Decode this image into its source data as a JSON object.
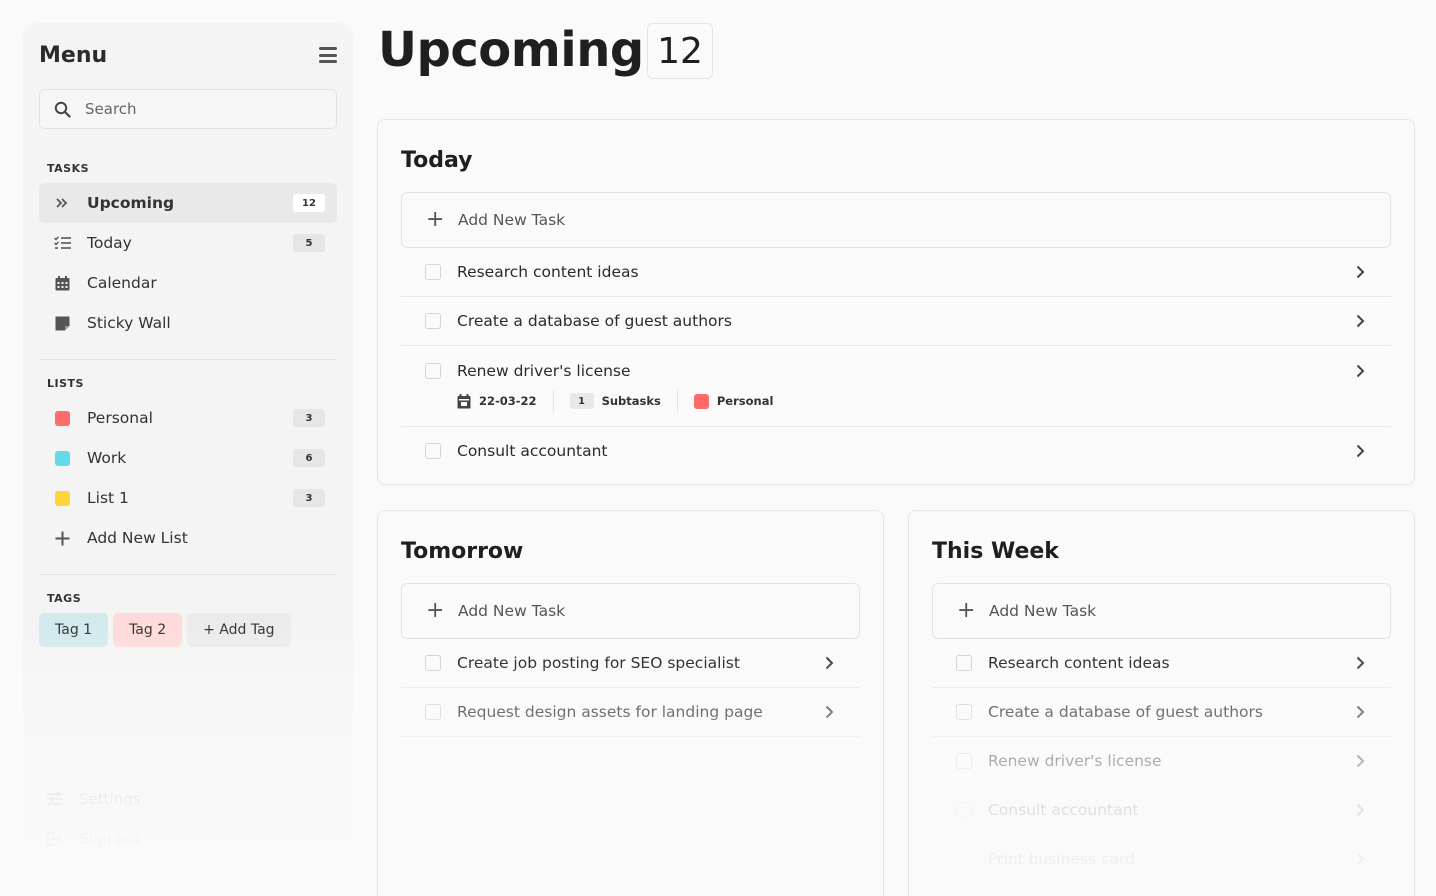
{
  "sidebar": {
    "title": "Menu",
    "search_placeholder": "Search",
    "tasks_label": "TASKS",
    "tasks": [
      {
        "label": "Upcoming",
        "count": "12",
        "icon": "double-chevron-right-icon"
      },
      {
        "label": "Today",
        "count": "5",
        "icon": "checklist-icon"
      },
      {
        "label": "Calendar",
        "icon": "calendar-icon"
      },
      {
        "label": "Sticky Wall",
        "icon": "sticky-note-icon"
      }
    ],
    "lists_label": "LISTS",
    "lists": [
      {
        "label": "Personal",
        "count": "3",
        "color": "#ff6b6b"
      },
      {
        "label": "Work",
        "count": "6",
        "color": "#66d9e8"
      },
      {
        "label": "List 1",
        "count": "3",
        "color": "#ffd43b"
      }
    ],
    "add_list_label": "Add New List",
    "tags_label": "TAGS",
    "tags": [
      {
        "label": "Tag 1",
        "color": "#d1eaed"
      },
      {
        "label": "Tag 2",
        "color": "#ffdada"
      },
      {
        "label": "+ Add Tag",
        "color": "#ebebeb"
      }
    ],
    "settings_label": "Settings",
    "signout_label": "Sign out"
  },
  "header": {
    "title": "Upcoming",
    "count": "12"
  },
  "today": {
    "title": "Today",
    "add_label": "Add New Task",
    "tasks": [
      {
        "text": "Research content ideas"
      },
      {
        "text": "Create a database of guest authors"
      },
      {
        "text": "Renew driver's license",
        "date": "22-03-22",
        "subtasks_count": "1",
        "subtasks_label": "Subtasks",
        "list": "Personal",
        "list_color": "#ff6b6b"
      },
      {
        "text": "Consult accountant"
      }
    ]
  },
  "tomorrow": {
    "title": "Tomorrow",
    "add_label": "Add New Task",
    "tasks": [
      {
        "text": "Create job posting for SEO specialist"
      },
      {
        "text": "Request design assets for landing page"
      }
    ]
  },
  "this_week": {
    "title": "This Week",
    "add_label": "Add New Task",
    "tasks": [
      {
        "text": "Research content ideas"
      },
      {
        "text": "Create a database of guest authors"
      },
      {
        "text": "Renew driver's license"
      },
      {
        "text": "Consult accountant"
      },
      {
        "text": "Print business card"
      }
    ]
  }
}
